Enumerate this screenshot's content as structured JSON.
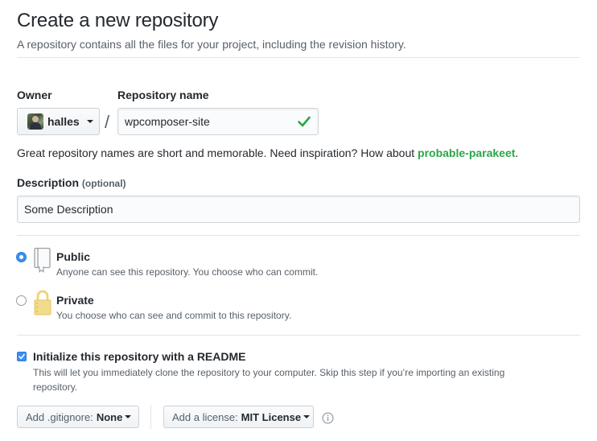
{
  "header": {
    "title": "Create a new repository",
    "subtitle": "A repository contains all the files for your project, including the revision history."
  },
  "owner": {
    "label": "Owner",
    "username": "halles"
  },
  "separator": "/",
  "repo_name": {
    "label": "Repository name",
    "value": "wpcomposer-site",
    "valid": true
  },
  "name_hint": {
    "text": "Great repository names are short and memorable. Need inspiration? How about ",
    "suggestion": "probable-parakeet",
    "end": "."
  },
  "description": {
    "label": "Description",
    "optional": "(optional)",
    "value": "Some Description"
  },
  "visibility": {
    "selected": "public",
    "public": {
      "title": "Public",
      "note": "Anyone can see this repository. You choose who can commit."
    },
    "private": {
      "title": "Private",
      "note": "You choose who can see and commit to this repository."
    }
  },
  "readme": {
    "checked": true,
    "label": "Initialize this repository with a README",
    "note": "This will let you immediately clone the repository to your computer. Skip this step if you’re importing an existing repository."
  },
  "gitignore": {
    "prefix": "Add .gitignore:",
    "value": "None"
  },
  "license": {
    "prefix": "Add a license:",
    "value": "MIT License"
  },
  "colors": {
    "accent": "#3b8ef0",
    "success": "#28a745",
    "muted": "#586069",
    "text": "#24292e"
  },
  "icons": [
    "checkmark-icon",
    "caret-down-icon",
    "book-icon",
    "lock-icon",
    "info-icon"
  ]
}
